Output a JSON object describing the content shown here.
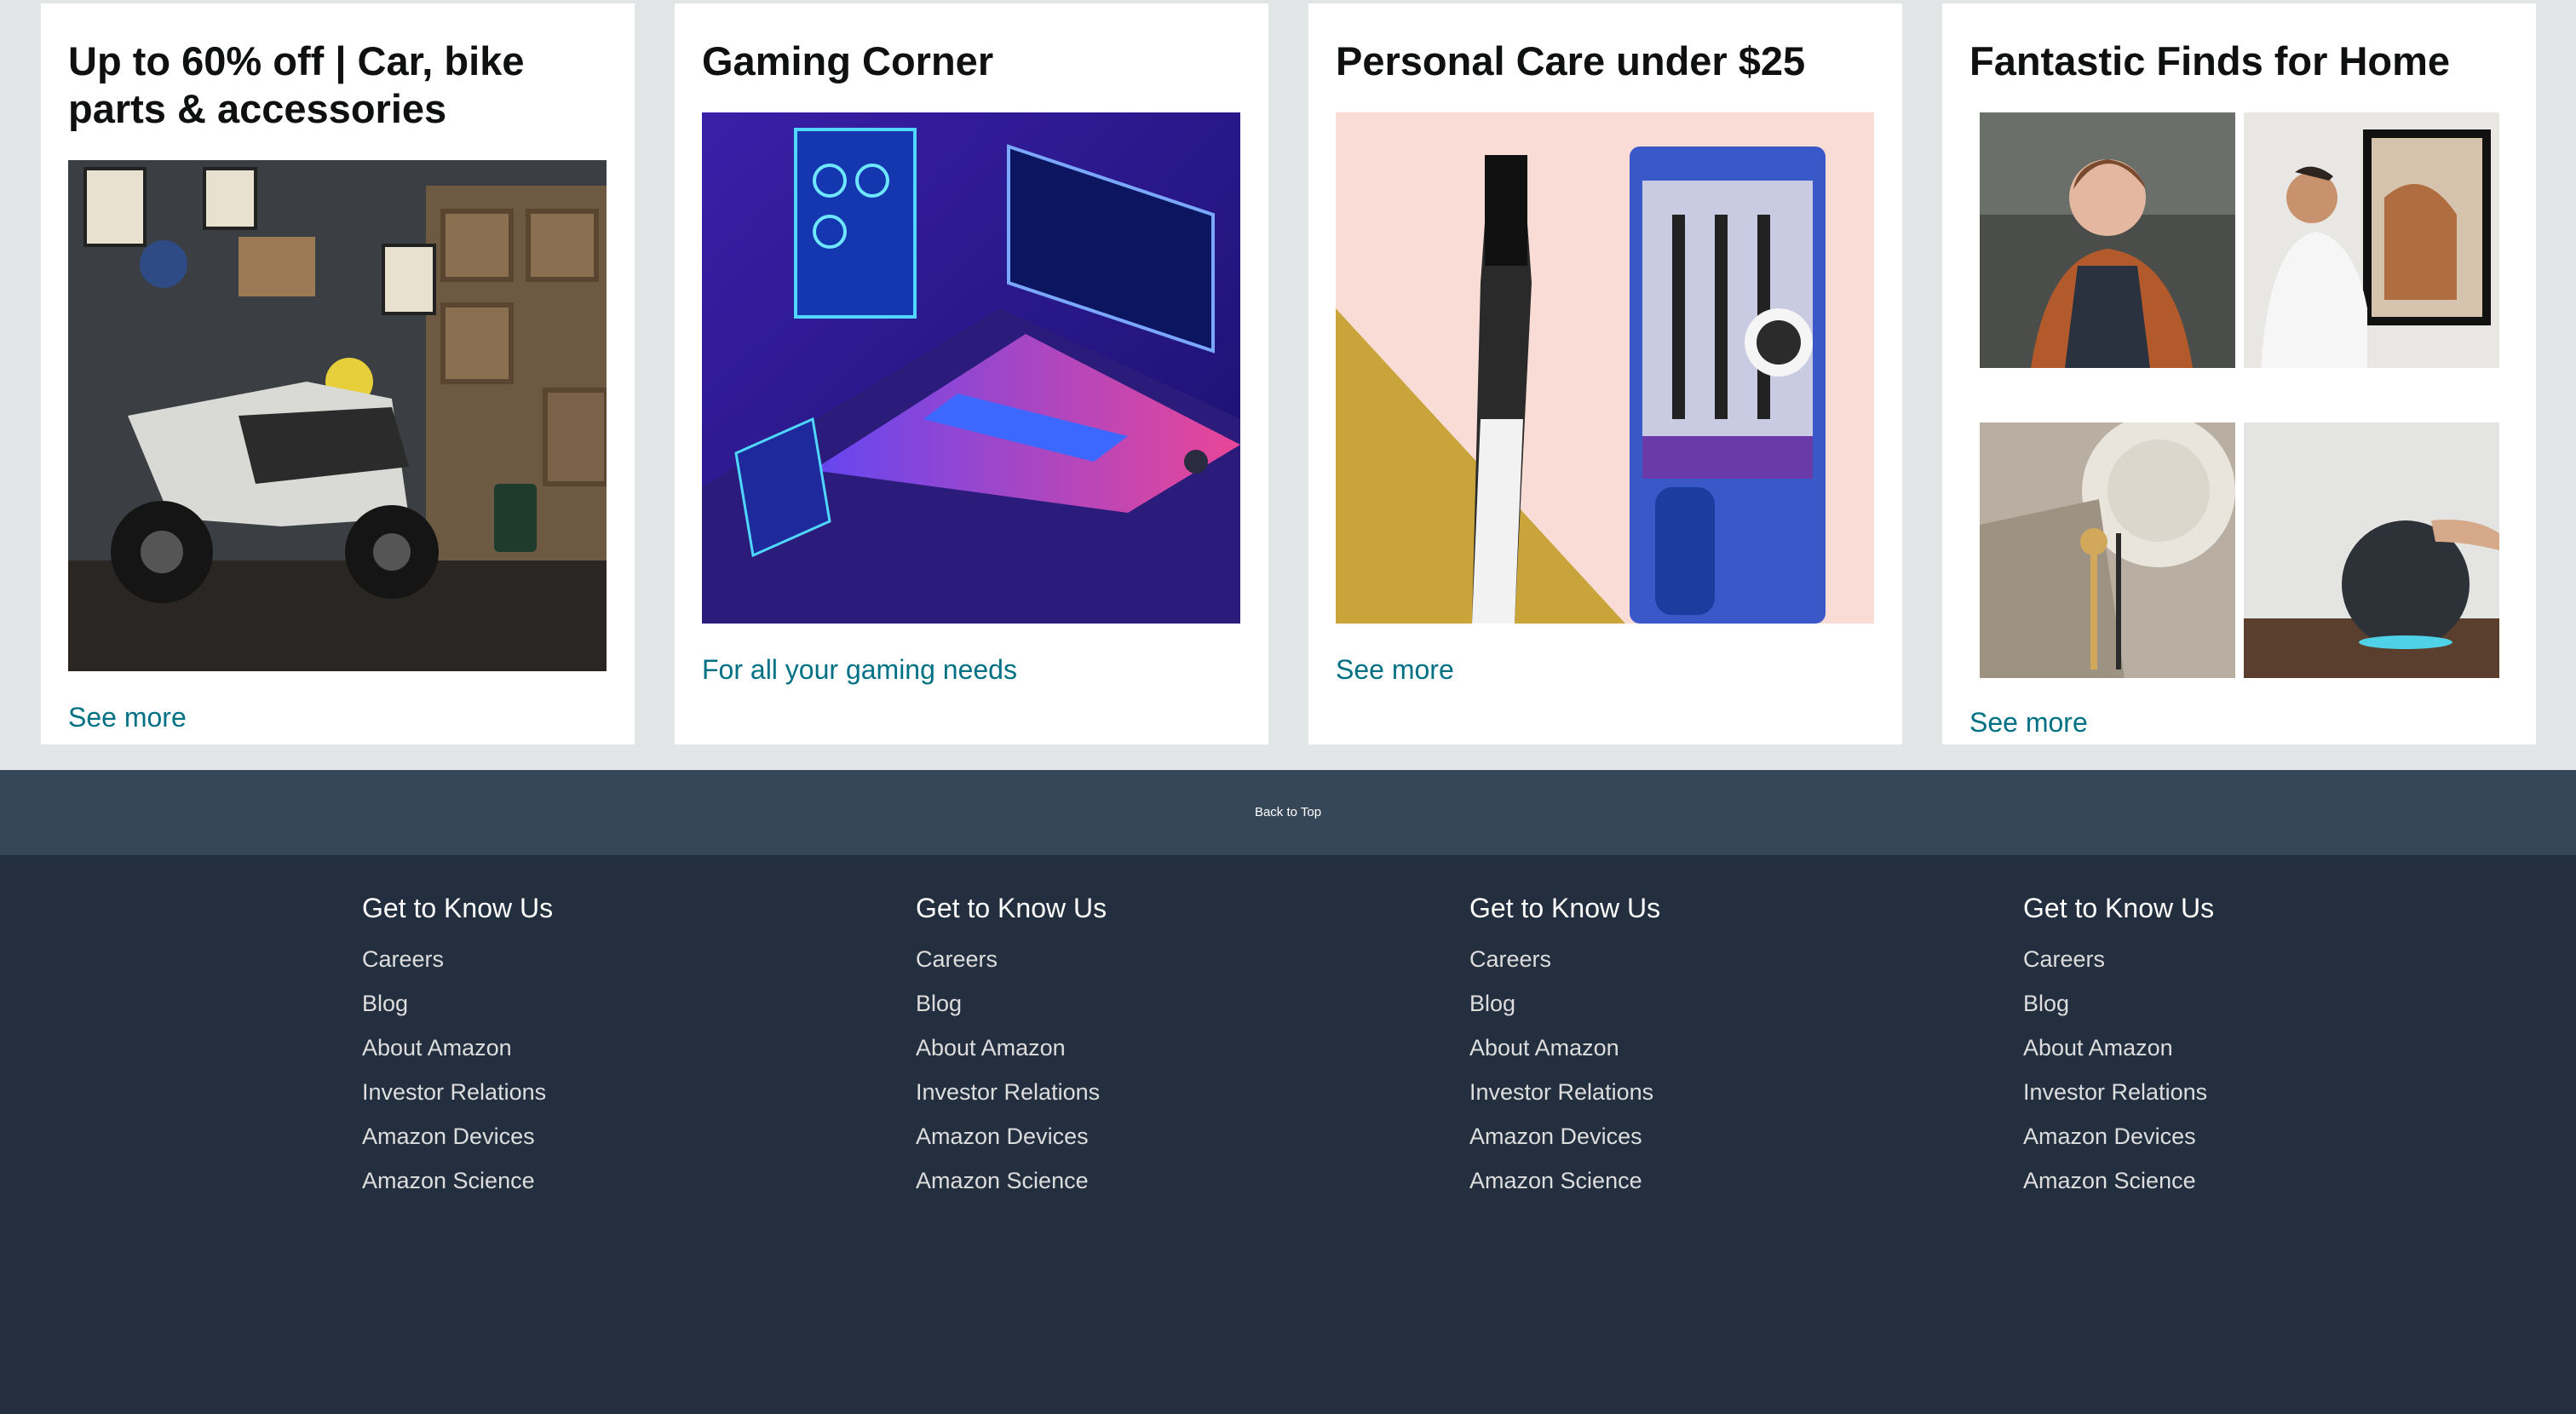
{
  "cards": [
    {
      "title": "Up to 60% off | Car, bike parts & accessories",
      "link": "See more"
    },
    {
      "title": "Gaming Corner",
      "link": "For all your gaming needs"
    },
    {
      "title": "Personal Care under $25",
      "link": "See more"
    },
    {
      "title": "Fantastic Finds for Home",
      "link": "See more"
    }
  ],
  "back_to_top": "Back to Top",
  "footer": {
    "columns": [
      {
        "heading": "Get to Know Us",
        "links": [
          "Careers",
          "Blog",
          "About Amazon",
          "Investor Relations",
          "Amazon Devices",
          "Amazon Science"
        ]
      },
      {
        "heading": "Get to Know Us",
        "links": [
          "Careers",
          "Blog",
          "About Amazon",
          "Investor Relations",
          "Amazon Devices",
          "Amazon Science"
        ]
      },
      {
        "heading": "Get to Know Us",
        "links": [
          "Careers",
          "Blog",
          "About Amazon",
          "Investor Relations",
          "Amazon Devices",
          "Amazon Science"
        ]
      },
      {
        "heading": "Get to Know Us",
        "links": [
          "Careers",
          "Blog",
          "About Amazon",
          "Investor Relations",
          "Amazon Devices",
          "Amazon Science"
        ]
      }
    ]
  }
}
